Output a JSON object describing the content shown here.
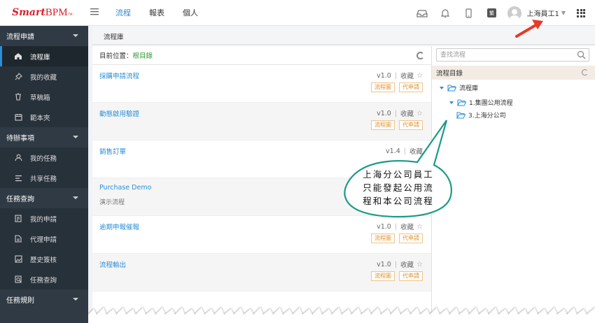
{
  "header": {
    "logo_smart": "Smart",
    "logo_bpm": "BPM",
    "logo_tm": "TM",
    "nav": [
      {
        "label": "流程",
        "active": true
      },
      {
        "label": "報表",
        "active": false
      },
      {
        "label": "個人",
        "active": false
      }
    ],
    "lang_badge": "繁",
    "user_name": "上海員工1"
  },
  "sidebar": {
    "groups": [
      {
        "label": "流程申請",
        "items": [
          {
            "label": "流程庫",
            "icon": "home-icon",
            "active": true
          },
          {
            "label": "我的收藏",
            "icon": "pin-icon"
          },
          {
            "label": "草稿箱",
            "icon": "trash-icon"
          },
          {
            "label": "範本夾",
            "icon": "calendar-icon"
          }
        ]
      },
      {
        "label": "待辦事項",
        "items": [
          {
            "label": "我的任務",
            "icon": "user-icon"
          },
          {
            "label": "共享任務",
            "icon": "list-icon"
          }
        ]
      },
      {
        "label": "任務查詢",
        "items": [
          {
            "label": "我的申請",
            "icon": "document-icon"
          },
          {
            "label": "代理申請",
            "icon": "document-edit-icon"
          },
          {
            "label": "歷史簽核",
            "icon": "image-icon"
          },
          {
            "label": "任務查詢",
            "icon": "search-doc-icon"
          }
        ]
      },
      {
        "label": "任務規則",
        "items": []
      }
    ]
  },
  "breadcrumb": {
    "title": "流程庫"
  },
  "list": {
    "location_label": "目前位置：",
    "location_link": "根目錄",
    "rows": [
      {
        "title": "採購申請流程",
        "sub": "",
        "version": "v1.0",
        "fav": "收藏",
        "tags": [
          "流程圖",
          "代申請"
        ]
      },
      {
        "title": "動態啟用驗證",
        "sub": "",
        "version": "v1.0",
        "fav": "收藏",
        "tags": [
          "流程圖",
          "代申請"
        ]
      },
      {
        "title": "銷售訂單",
        "sub": "",
        "version": "v1.4",
        "fav": "收藏",
        "tags": []
      },
      {
        "title": "Purchase Demo",
        "sub": "演示流程",
        "version": "",
        "fav": "",
        "tags": []
      },
      {
        "title": "逾期申報催報",
        "sub": "",
        "version": "v1.0",
        "fav": "收藏",
        "tags": [
          "流程圖",
          "代申請"
        ]
      },
      {
        "title": "流程輸出",
        "sub": "",
        "version": "v1.0",
        "fav": "收藏",
        "tags": [
          "流程圖",
          "代申請"
        ]
      }
    ]
  },
  "tree": {
    "search_placeholder": "查找流程",
    "head": "流程目錄",
    "nodes": [
      {
        "label": "流程庫"
      },
      {
        "label": "1.集團公用流程"
      },
      {
        "label": "3.上海分公司"
      }
    ]
  },
  "callout": {
    "line1": "上海分公司員工",
    "line2": "只能發起公用流",
    "line3": "程和本公司流程"
  },
  "colors": {
    "accent": "#2a8fd6",
    "brand": "#d8202a",
    "sidebar": "#2f3a44",
    "callout_border": "#1a9a88",
    "arrow": "#e63a2a"
  }
}
